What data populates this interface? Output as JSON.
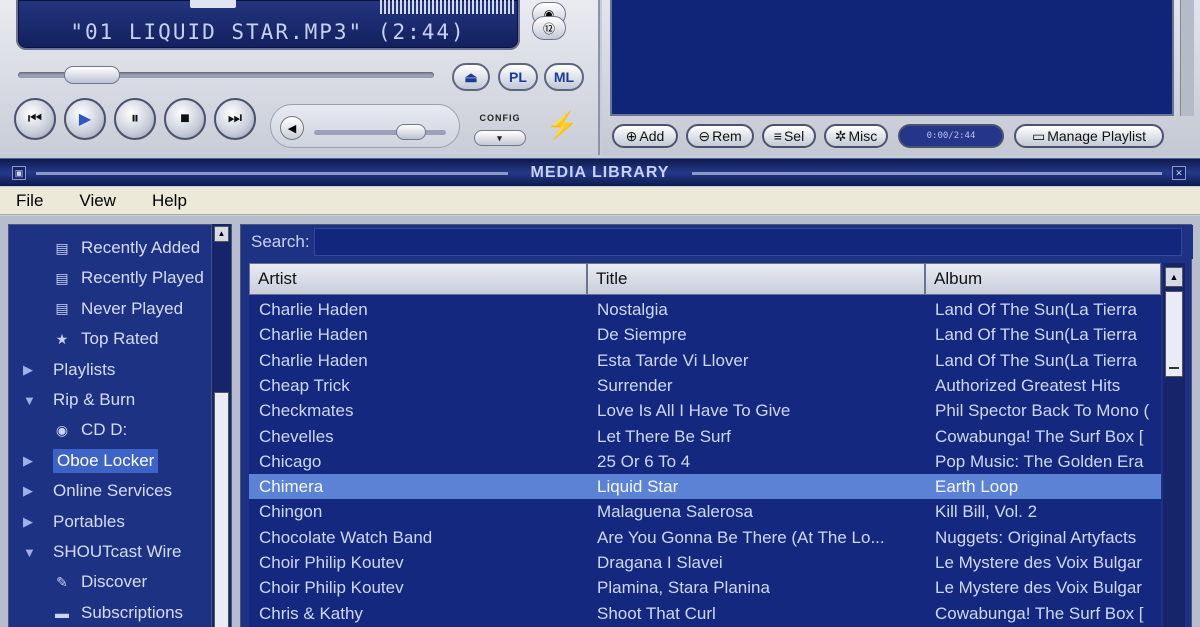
{
  "player": {
    "track_display": "\"01 LIQUID STAR.MP3\" (2:44)",
    "buttons": {
      "eject": "⏏",
      "pl": "PL",
      "ml": "ML",
      "prev": "⏮",
      "play": "▶",
      "pause": "⏸",
      "stop": "■",
      "next": "⏭"
    },
    "config_label": "CONFIG",
    "config_arrow": "▾",
    "volume_icon": "◀",
    "side_buttons": [
      "◉",
      "⑫"
    ]
  },
  "playlist_panel": {
    "buttons": [
      "Add",
      "Rem",
      "Sel",
      "Misc"
    ],
    "button_icons": [
      "⊕",
      "⊖",
      "≡",
      "✲"
    ],
    "time": "0:00/2:44",
    "manage_label": "Manage Playlist"
  },
  "media_library": {
    "title": "MEDIA LIBRARY",
    "menu": [
      "File",
      "View",
      "Help"
    ],
    "tree": [
      {
        "label": "Recently Added",
        "icon": "doc-icon",
        "glyph": "▤",
        "indent": 2,
        "selected": false
      },
      {
        "label": "Recently Played",
        "icon": "doc-icon",
        "glyph": "▤",
        "indent": 2,
        "selected": false
      },
      {
        "label": "Never Played",
        "icon": "doc-icon",
        "glyph": "▤",
        "indent": 2,
        "selected": false
      },
      {
        "label": "Top Rated",
        "icon": "star-doc-icon",
        "glyph": "★",
        "indent": 2,
        "selected": false
      },
      {
        "label": "Playlists",
        "icon": "expand-icon",
        "glyph": "▶",
        "indent": 1,
        "selected": false
      },
      {
        "label": "Rip & Burn",
        "icon": "collapse-icon",
        "glyph": "▼",
        "indent": 1,
        "selected": false
      },
      {
        "label": "CD D:",
        "icon": "cd-icon",
        "glyph": "◉",
        "indent": 2,
        "selected": false
      },
      {
        "label": "Oboe Locker",
        "icon": "expand-icon",
        "glyph": "▶",
        "indent": 1,
        "selected": true
      },
      {
        "label": "Online Services",
        "icon": "expand-icon",
        "glyph": "▶",
        "indent": 1,
        "selected": false
      },
      {
        "label": "Portables",
        "icon": "expand-icon",
        "glyph": "▶",
        "indent": 1,
        "selected": false
      },
      {
        "label": "SHOUTcast Wire",
        "icon": "collapse-icon",
        "glyph": "▼",
        "indent": 1,
        "selected": false
      },
      {
        "label": "Discover",
        "icon": "wand-icon",
        "glyph": "✎",
        "indent": 2,
        "selected": false
      },
      {
        "label": "Subscriptions",
        "icon": "folder-icon",
        "glyph": "▬",
        "indent": 2,
        "selected": false
      }
    ],
    "search_label": "Search:",
    "search_value": "",
    "columns": [
      "Artist",
      "Title",
      "Album"
    ],
    "rows": [
      [
        "Charlie Haden",
        "Nostalgia",
        "Land Of The Sun(La Tierra"
      ],
      [
        "Charlie Haden",
        "De Siempre",
        "Land Of The Sun(La Tierra"
      ],
      [
        "Charlie Haden",
        "Esta Tarde Vi Llover",
        "Land Of The Sun(La Tierra"
      ],
      [
        "Cheap Trick",
        "Surrender",
        "Authorized Greatest Hits"
      ],
      [
        "Checkmates",
        "Love Is All I Have To Give",
        "Phil Spector Back To Mono ("
      ],
      [
        "Chevelles",
        "Let There Be Surf",
        "Cowabunga! The Surf Box ["
      ],
      [
        "Chicago",
        "25 Or 6 To 4",
        "Pop Music: The Golden Era"
      ],
      [
        "Chimera",
        "Liquid Star",
        "Earth Loop"
      ],
      [
        "Chingon",
        "Malaguena Salerosa",
        "Kill Bill, Vol. 2"
      ],
      [
        "Chocolate Watch Band",
        "Are You Gonna Be There (At The Lo...",
        "Nuggets: Original Artyfacts"
      ],
      [
        "Choir Philip Koutev",
        "Dragana I Slavei",
        "Le Mystere des Voix Bulgar"
      ],
      [
        "Choir Philip Koutev",
        "Plamina, Stara Planina",
        "Le Mystere des Voix Bulgar"
      ],
      [
        "Chris & Kathy",
        "Shoot That Curl",
        "Cowabunga! The Surf Box ["
      ]
    ],
    "selected_row": 7
  },
  "colors": {
    "library_bg": "#1e3284",
    "selection": "#5c82d6",
    "text": "#cfd8f5"
  }
}
